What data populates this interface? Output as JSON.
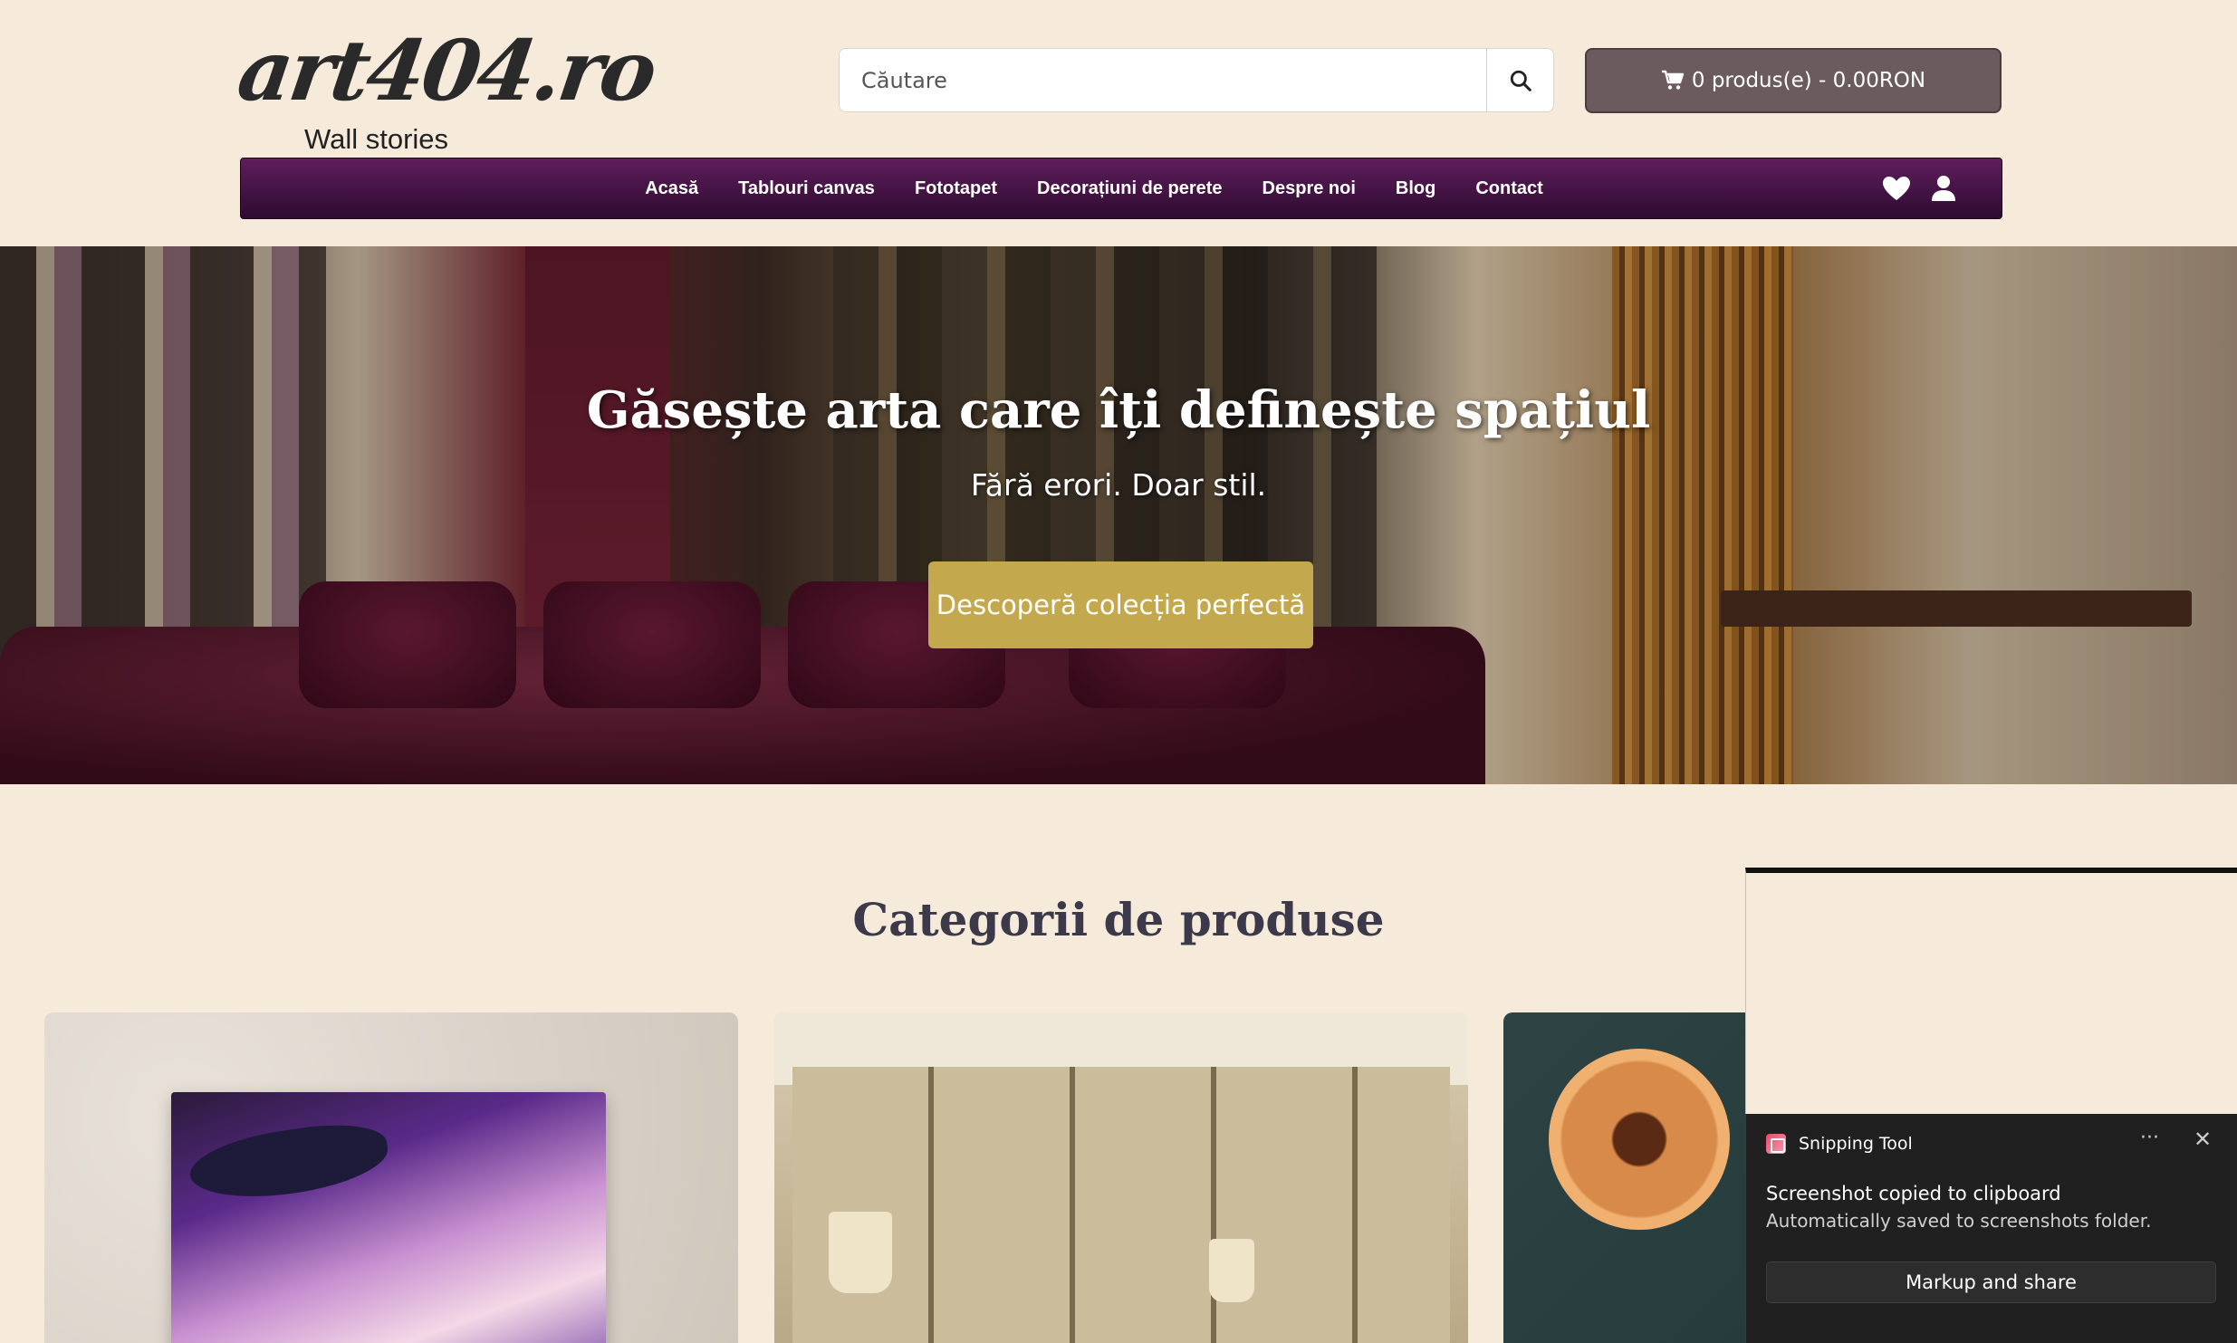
{
  "header": {
    "logo_text": "art404.ro",
    "logo_tagline": "Wall stories",
    "search": {
      "placeholder": "Căutare",
      "icon": "search-icon"
    },
    "cart": {
      "icon": "cart-icon",
      "label": "0 produs(e) - 0.00RON"
    }
  },
  "nav": {
    "items": [
      {
        "label": "Acasă"
      },
      {
        "label": "Tablouri canvas"
      },
      {
        "label": "Fototapet"
      },
      {
        "label": "Decorațiuni de perete"
      },
      {
        "label": "Despre noi"
      },
      {
        "label": "Blog"
      },
      {
        "label": "Contact"
      }
    ],
    "icons": [
      "heart-icon",
      "user-icon"
    ]
  },
  "hero": {
    "title": "Găsește arta care îți definește spațiul",
    "subtitle": "Fără erori. Doar stil.",
    "cta_label": "Descoperă colecția perfectă"
  },
  "categories": {
    "title": "Categorii de produse"
  },
  "toast": {
    "app_name": "Snipping Tool",
    "message": "Screenshot copied to clipboard",
    "detail": "Automatically saved to screenshots folder.",
    "button_label": "Markup and share",
    "more_label": "···",
    "close_label": "✕"
  },
  "colors": {
    "background": "#f6eadb",
    "nav_gradient_top": "#5e1e5c",
    "nav_gradient_bottom": "#2e0b30",
    "cart_bg": "#6b5a5e",
    "cta_bg": "#c4a84e",
    "toast_bg": "#202020"
  }
}
